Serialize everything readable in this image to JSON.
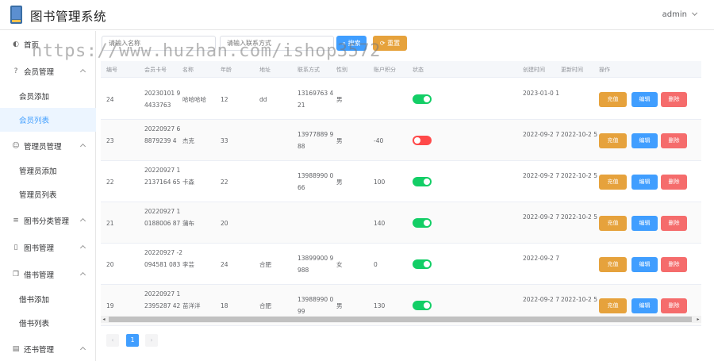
{
  "header": {
    "title": "图书管理系统",
    "user": "admin"
  },
  "sidebar": {
    "items": [
      {
        "label": "首页"
      },
      {
        "label": "会员管理"
      },
      {
        "label": "会员添加"
      },
      {
        "label": "会员列表"
      },
      {
        "label": "管理员管理"
      },
      {
        "label": "管理员添加"
      },
      {
        "label": "管理员列表"
      },
      {
        "label": "图书分类管理"
      },
      {
        "label": "图书管理"
      },
      {
        "label": "借书管理"
      },
      {
        "label": "借书添加"
      },
      {
        "label": "借书列表"
      },
      {
        "label": "还书管理"
      }
    ]
  },
  "search": {
    "name_placeholder": "请输入名称",
    "phone_placeholder": "请输入联系方式",
    "search_label": "搜索",
    "reset_label": "重置"
  },
  "table": {
    "headers": [
      "编号",
      "会员卡号",
      "名称",
      "年龄",
      "地址",
      "联系方式",
      "性别",
      "账户积分",
      "状态",
      "创建时间",
      "更新时间",
      "操作"
    ],
    "actions": {
      "recharge": "充值",
      "edit": "编辑",
      "delete": "删除"
    },
    "rows": [
      {
        "id": "24",
        "card": "20230101 94433763",
        "name": "哈哈哈哈",
        "age": "12",
        "addr": "dd",
        "phone": "13169763 421",
        "gender": "男",
        "points": "",
        "status": "on",
        "created": "2023-01-0 1",
        "updated": ""
      },
      {
        "id": "23",
        "card": "20220927 68879239 4",
        "name": "杰克",
        "age": "33",
        "addr": "",
        "phone": "13977889 988",
        "gender": "男",
        "points": "-40",
        "status": "off",
        "created": "2022-09-2 7",
        "updated": "2022-10-2 5"
      },
      {
        "id": "22",
        "card": "20220927 12137164 65",
        "name": "卡森",
        "age": "22",
        "addr": "",
        "phone": "13988990 066",
        "gender": "男",
        "points": "100",
        "status": "on",
        "created": "2022-09-2 7",
        "updated": "2022-10-2 5"
      },
      {
        "id": "21",
        "card": "20220927 10188006 87",
        "name": "蒲布",
        "age": "20",
        "addr": "",
        "phone": "",
        "gender": "",
        "points": "140",
        "status": "on",
        "created": "2022-09-2 7",
        "updated": "2022-10-2 5"
      },
      {
        "id": "20",
        "card": "20220927 -2094581 083",
        "name": "李芸",
        "age": "24",
        "addr": "合肥",
        "phone": "13899900 9988",
        "gender": "女",
        "points": "0",
        "status": "on",
        "created": "2022-09-2 7",
        "updated": ""
      },
      {
        "id": "19",
        "card": "20220927 12395287 42",
        "name": "苗洋洋",
        "age": "18",
        "addr": "合肥",
        "phone": "13988990 099",
        "gender": "男",
        "points": "130",
        "status": "on",
        "created": "2022-09-2 7",
        "updated": "2022-10-2 5"
      }
    ]
  },
  "pagination": {
    "prev": "‹",
    "current": "1",
    "next": "›"
  },
  "watermark": "https://www.huzhan.com/ishop3572"
}
